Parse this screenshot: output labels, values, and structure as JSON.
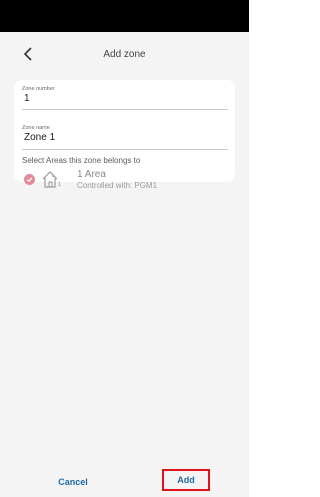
{
  "header": {
    "title": "Add zone",
    "back_icon": "chevron-left-icon"
  },
  "form": {
    "zone_number": {
      "label": "Zone number",
      "value": "1"
    },
    "zone_name": {
      "label": "Zone name",
      "value": "Zone 1"
    },
    "areas_caption": "Select Areas this zone belongs to",
    "areas": [
      {
        "index": "1",
        "name": "1 Area",
        "subtitle": "Controlled with: PGM1",
        "selected": true,
        "icon": "house-icon"
      }
    ]
  },
  "footer": {
    "cancel_label": "Cancel",
    "add_label": "Add"
  },
  "colors": {
    "accent": "#1f6aa5",
    "check": "#e38b9a",
    "highlight": "#e0131a",
    "background": "#f4f4f4"
  }
}
